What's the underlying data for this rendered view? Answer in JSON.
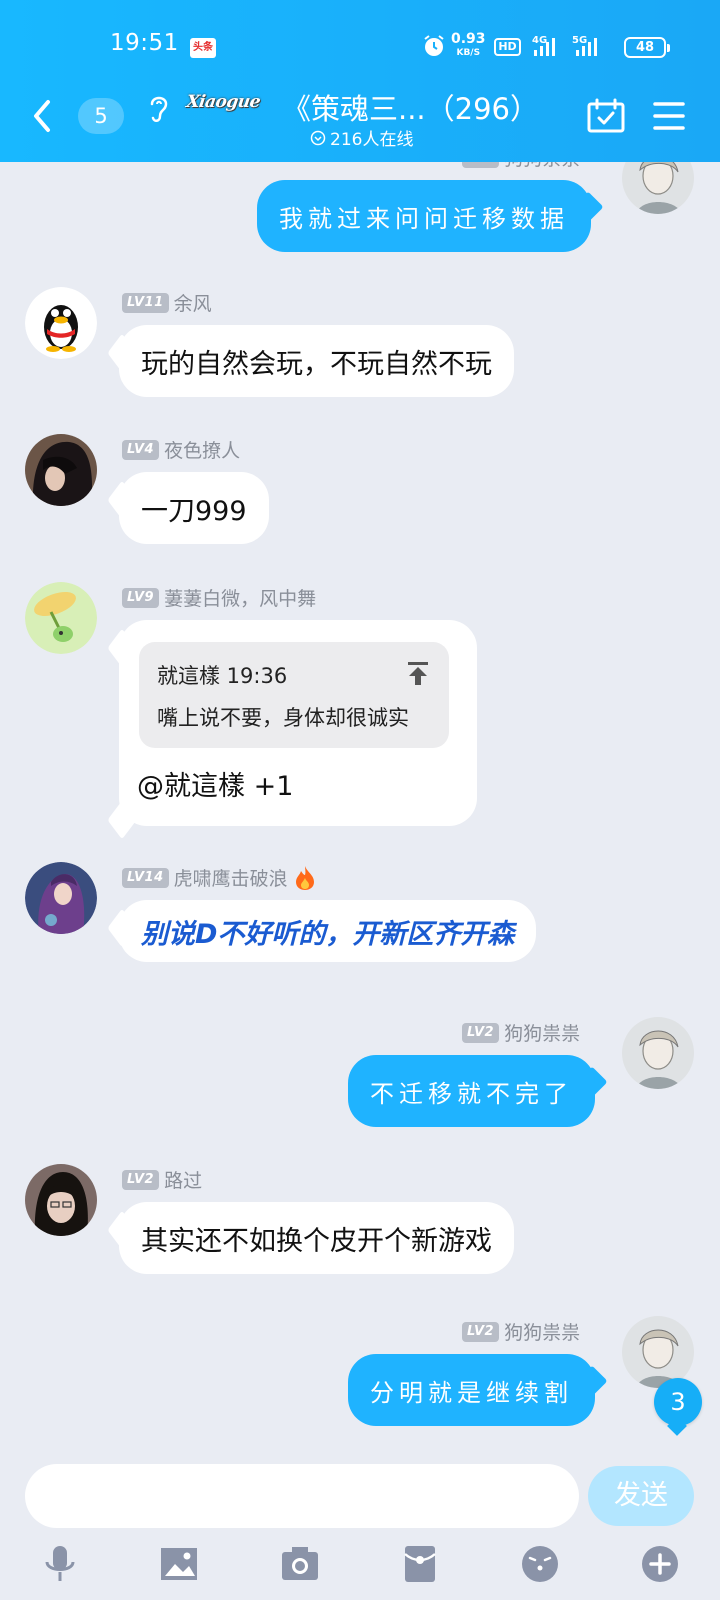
{
  "status_bar": {
    "time": "19:51",
    "badge": "头条",
    "net_speed": "0.93",
    "net_unit": "KB/S",
    "hd": "HD",
    "network1": "4G",
    "network2": "5G",
    "battery": "48"
  },
  "header": {
    "unread_count": "5",
    "logo_text": "Xiaogue",
    "title": "《策魂三...（296）",
    "online": "216人在线"
  },
  "messages": [
    {
      "side": "right",
      "level": "",
      "sender": "狗狗祟祟",
      "text": "我就过来问问迁移数据"
    },
    {
      "side": "left",
      "level": "LV11",
      "sender": "余风",
      "text": "玩的自然会玩，不玩自然不玩"
    },
    {
      "side": "left",
      "level": "LV4",
      "sender": "夜色撩人",
      "text": "一刀999"
    },
    {
      "side": "left",
      "level": "LV9",
      "sender": "萋萋白微，风中舞",
      "reply": {
        "head": "就這樣 19:36",
        "quote": "嘴上说不要，身体却很诚实"
      },
      "text": "@就這樣 +1"
    },
    {
      "side": "left",
      "level": "LV14",
      "sender": "虎啸鹰击破浪",
      "text": "别说D不好听的，开新区齐开森"
    },
    {
      "side": "right",
      "level": "LV2",
      "sender": "狗狗祟祟",
      "text": "不迁移就不完了"
    },
    {
      "side": "left",
      "level": "LV2",
      "sender": "路过",
      "text": "其实还不如换个皮开个新游戏"
    },
    {
      "side": "right",
      "level": "LV2",
      "sender": "狗狗祟祟",
      "text": "分明就是继续割"
    }
  ],
  "new_message_count": "3",
  "composer": {
    "placeholder": "",
    "send_label": "发送"
  },
  "toolbar": [
    "mic-icon",
    "image-icon",
    "camera-icon",
    "red-packet-icon",
    "emoji-icon",
    "plus-icon"
  ],
  "colors": {
    "header": "#1aa8f6",
    "bubble_self": "#1fb3ff",
    "background": "#e9ecf3",
    "styled_text": "#1a5bd1",
    "send_disabled": "#b3e6ff"
  }
}
